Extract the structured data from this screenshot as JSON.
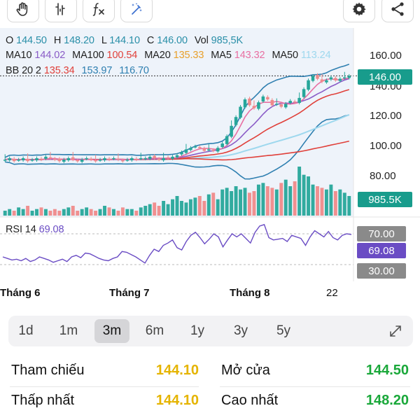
{
  "colors": {
    "up": "#26a69a",
    "down": "#ef8a8a",
    "ma_purple": "#8a5cc7",
    "ma100_red": "#e0403a",
    "ma20_orange": "#e8a02c",
    "ma5_pink": "#e86fa2",
    "ma50_lightblue": "#9ed8ee",
    "bb_blue": "#2e7fb0",
    "gold": "#e5b400",
    "green": "#1aa83a",
    "rsi_purple": "#6a4cc4",
    "gray_tag": "#8a8a8a"
  },
  "toolbar": {
    "buttons": [
      "hand-icon",
      "indicator-bars-icon",
      "function-fx-icon",
      "magic-draw-icon"
    ],
    "right_buttons": [
      "settings-gear-icon",
      "share-icon"
    ]
  },
  "ohlc": {
    "o_label": "O",
    "o_value": "144.50",
    "h_label": "H",
    "h_value": "148.20",
    "l_label": "L",
    "l_value": "144.10",
    "c_label": "C",
    "c_value": "146.00",
    "vol_label": "Vol",
    "vol_value": "985,5K"
  },
  "ma": {
    "ma10_label": "MA10",
    "ma10_value": "144.02",
    "ma100_label": "MA100",
    "ma100_value": "100.54",
    "ma20_label": "MA20",
    "ma20_value": "135.33",
    "ma5_label": "MA5",
    "ma5_value": "143.32",
    "ma50_label": "MA50",
    "ma50_value": "113.24"
  },
  "bb": {
    "label": "BB 20 2",
    "v1": "135.34",
    "v2": "153.97",
    "v3": "116.70"
  },
  "price_axis": [
    "160.00",
    "140.00",
    "120.00",
    "100.00",
    "80.00"
  ],
  "last_price_tag": "146.00",
  "volume_tag": "985.5K",
  "rsi": {
    "label": "RSI 14",
    "value": "69.08",
    "upper": "70.00",
    "lower": "30.00",
    "series": [
      40,
      38,
      36,
      37,
      35,
      38,
      34,
      36,
      40,
      38,
      36,
      33,
      35,
      37,
      34,
      40,
      42,
      39,
      45,
      44,
      41,
      38,
      36,
      35,
      38,
      40,
      47,
      46,
      43,
      40,
      36,
      32,
      42,
      50,
      47,
      55,
      58,
      62,
      52,
      49,
      60,
      68,
      72,
      65,
      57,
      63,
      70,
      66,
      53,
      62,
      70,
      66,
      70,
      64,
      58,
      72,
      80,
      82,
      65,
      62,
      63,
      64,
      60,
      68,
      66,
      64,
      55,
      66,
      74,
      70,
      66,
      73,
      65,
      62,
      68,
      70,
      69
    ]
  },
  "months": [
    "Tháng 6",
    "Tháng 7",
    "Tháng 8",
    "22"
  ],
  "timeframes": [
    "1d",
    "1m",
    "3m",
    "6m",
    "1y",
    "3y",
    "5y"
  ],
  "active_timeframe": "3m",
  "stats": {
    "ref_label": "Tham chiếu",
    "ref_value": "144.10",
    "open_label": "Mở cửa",
    "open_value": "144.50",
    "low_label": "Thấp nhất",
    "low_value": "144.10",
    "high_label": "Cao nhất",
    "high_value": "148.20"
  },
  "chart_data": {
    "type": "candlestick",
    "price_range": [
      70,
      170
    ],
    "closes": [
      89,
      90,
      88,
      89,
      90,
      88,
      89,
      90,
      89,
      91,
      90,
      89,
      88,
      89,
      90,
      89,
      88,
      89,
      90,
      89,
      88,
      89,
      90,
      89,
      90,
      89,
      88,
      89,
      90,
      89,
      90,
      90,
      91,
      90,
      89,
      90,
      90,
      91,
      92,
      94,
      96,
      97,
      98,
      97,
      95,
      96,
      95,
      97,
      100,
      105,
      112,
      118,
      125,
      130,
      126,
      124,
      128,
      132,
      130,
      126,
      127,
      125,
      127,
      129,
      128,
      131,
      137,
      143,
      146,
      144,
      142,
      143,
      145,
      143,
      144,
      145,
      146
    ],
    "volumes": [
      3,
      4,
      3,
      5,
      4,
      6,
      3,
      4,
      5,
      4,
      3,
      4,
      3,
      4,
      5,
      6,
      3,
      4,
      5,
      4,
      3,
      4,
      6,
      5,
      4,
      3,
      5,
      4,
      4,
      3,
      5,
      6,
      7,
      8,
      6,
      9,
      7,
      10,
      12,
      9,
      8,
      10,
      11,
      12,
      9,
      13,
      14,
      10,
      16,
      17,
      15,
      18,
      16,
      17,
      14,
      15,
      19,
      20,
      18,
      17,
      16,
      20,
      22,
      18,
      21,
      30,
      25,
      24,
      19,
      18,
      17,
      16,
      19,
      15,
      16,
      14,
      12
    ]
  }
}
